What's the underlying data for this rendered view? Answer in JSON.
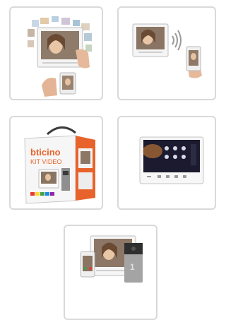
{
  "products": [
    {
      "id": "tile-1",
      "icon": "monitor-and-phone-collage-icon"
    },
    {
      "id": "tile-2",
      "icon": "monitor-wifi-phone-icon"
    },
    {
      "id": "tile-3",
      "icon": "video-kit-box-icon",
      "box_brand": "bticino",
      "box_label": "KIT VIDEO"
    },
    {
      "id": "tile-4",
      "icon": "smart-home-monitor-icon"
    },
    {
      "id": "tile-5",
      "icon": "monitor-phone-door-panel-icon"
    }
  ],
  "colors": {
    "tile_border": "#d9d9d9",
    "brand_orange": "#e8632b",
    "screen_dark": "#1c1a2e"
  }
}
